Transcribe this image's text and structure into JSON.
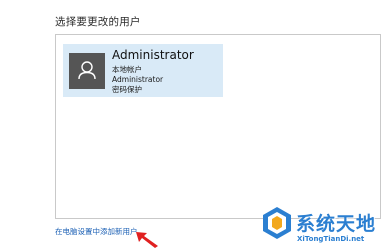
{
  "header": {
    "title": "选择要更改的用户"
  },
  "users": [
    {
      "name": "Administrator",
      "account_type": "本地帐户",
      "group": "Administrator",
      "password_status": "密码保护",
      "avatar_icon": "user-icon",
      "selected": true
    }
  ],
  "footer": {
    "add_user_link": "在电脑设置中添加新用户"
  },
  "watermark": {
    "brand": "系统天地",
    "url": "XiTongTianDi.net",
    "logo_icon": "logo-icon"
  },
  "colors": {
    "selected_card": "#d9eaf7",
    "link": "#1a5fb4",
    "avatar_bg": "#555555",
    "arrow": "#e02020",
    "watermark": "#2b7fd1"
  }
}
